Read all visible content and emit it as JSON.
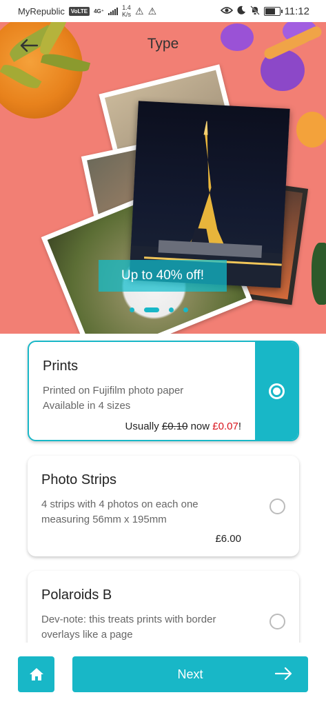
{
  "status_bar": {
    "carrier": "MyRepublic",
    "volte_badge": "VoLTE",
    "network_type": "4G⁺",
    "speed_value": "1.4",
    "speed_unit": "K/s",
    "time": "11:12",
    "icons": [
      "volte-icon",
      "signal-icon",
      "warning-icon",
      "warning-icon",
      "eye-icon",
      "moon-icon",
      "bell-off-icon",
      "battery-icon"
    ]
  },
  "header": {
    "title": "Type",
    "back_icon": "arrow-left-icon"
  },
  "hero": {
    "promo_text": "Up to 40% off!",
    "carousel": {
      "count": 4,
      "active_index": 1
    }
  },
  "options": [
    {
      "title": "Prints",
      "description_line1": "Printed on Fujifilm photo paper",
      "description_line2": "Available in 4 sizes",
      "price_prefix": "Usually ",
      "price_old": "£0.10",
      "price_mid": " now ",
      "price_new": "£0.07",
      "price_suffix": "!",
      "selected": true
    },
    {
      "title": "Photo Strips",
      "description_line1": "4 strips with 4 photos on each one",
      "description_line2": "measuring 56mm x 195mm",
      "price": "£6.00",
      "selected": false
    },
    {
      "title": "Polaroids B",
      "description_line1": "Dev-note: this treats prints with border",
      "description_line2": "overlays like a page",
      "selected": false
    }
  ],
  "bottom_bar": {
    "home_icon": "home-icon",
    "next_label": "Next",
    "next_icon": "arrow-right-icon"
  },
  "colors": {
    "accent": "#18b7c7",
    "hero_background": "#f27f74",
    "sale_price": "#d9151e"
  }
}
